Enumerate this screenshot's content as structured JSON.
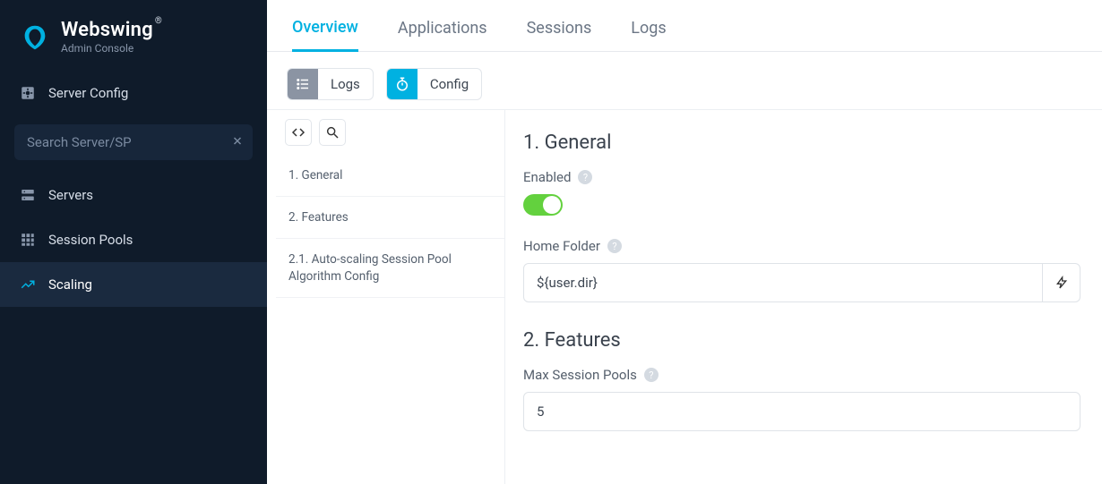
{
  "brand": {
    "title": "Webswing",
    "subtitle": "Admin Console"
  },
  "sidebar": {
    "server_config_label": "Server Config",
    "search_placeholder": "Search Server/SP",
    "items": [
      {
        "label": "Servers"
      },
      {
        "label": "Session Pools"
      },
      {
        "label": "Scaling"
      }
    ]
  },
  "tabs": {
    "overview": "Overview",
    "applications": "Applications",
    "sessions": "Sessions",
    "logs": "Logs"
  },
  "toolbar": {
    "logs_label": "Logs",
    "config_label": "Config"
  },
  "nav": {
    "items": [
      {
        "label": "1. General"
      },
      {
        "label": "2. Features"
      },
      {
        "label": "2.1. Auto-scaling Session Pool Algorithm Config"
      }
    ]
  },
  "form": {
    "section_general": "1. General",
    "enabled_label": "Enabled",
    "enabled_value": true,
    "home_folder_label": "Home Folder",
    "home_folder_value": "${user.dir}",
    "section_features": "2. Features",
    "max_session_pools_label": "Max Session Pools",
    "max_session_pools_value": "5"
  }
}
